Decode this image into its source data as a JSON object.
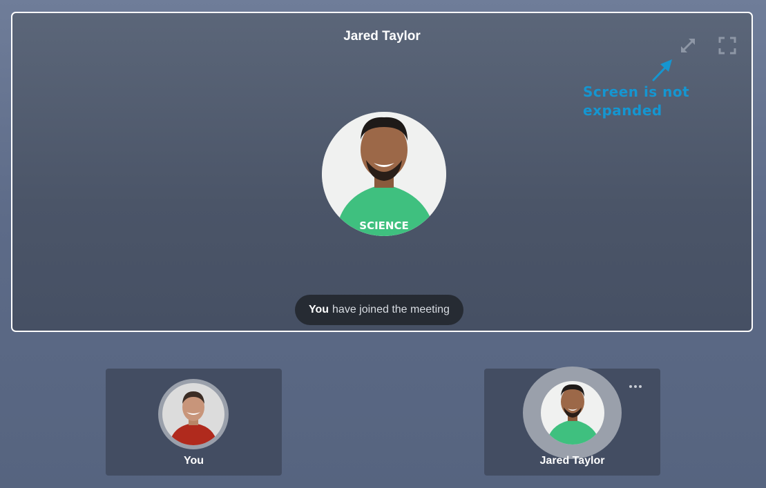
{
  "stage": {
    "participant_name": "Jared Taylor",
    "expand_icon": "expand-arrows-icon",
    "fullscreen_icon": "fullscreen-corners-icon",
    "annotation": "Screen is not expanded",
    "annotation_color": "#1596d1",
    "avatar_shirt_text": "SCIENCE"
  },
  "toast": {
    "bold": "You",
    "rest": "have joined the meeting"
  },
  "tiles": [
    {
      "name": "You",
      "avatar": "user-photo"
    },
    {
      "name": "Jared Taylor",
      "avatar": "user-photo",
      "menu_icon": "more-dots-icon"
    }
  ]
}
